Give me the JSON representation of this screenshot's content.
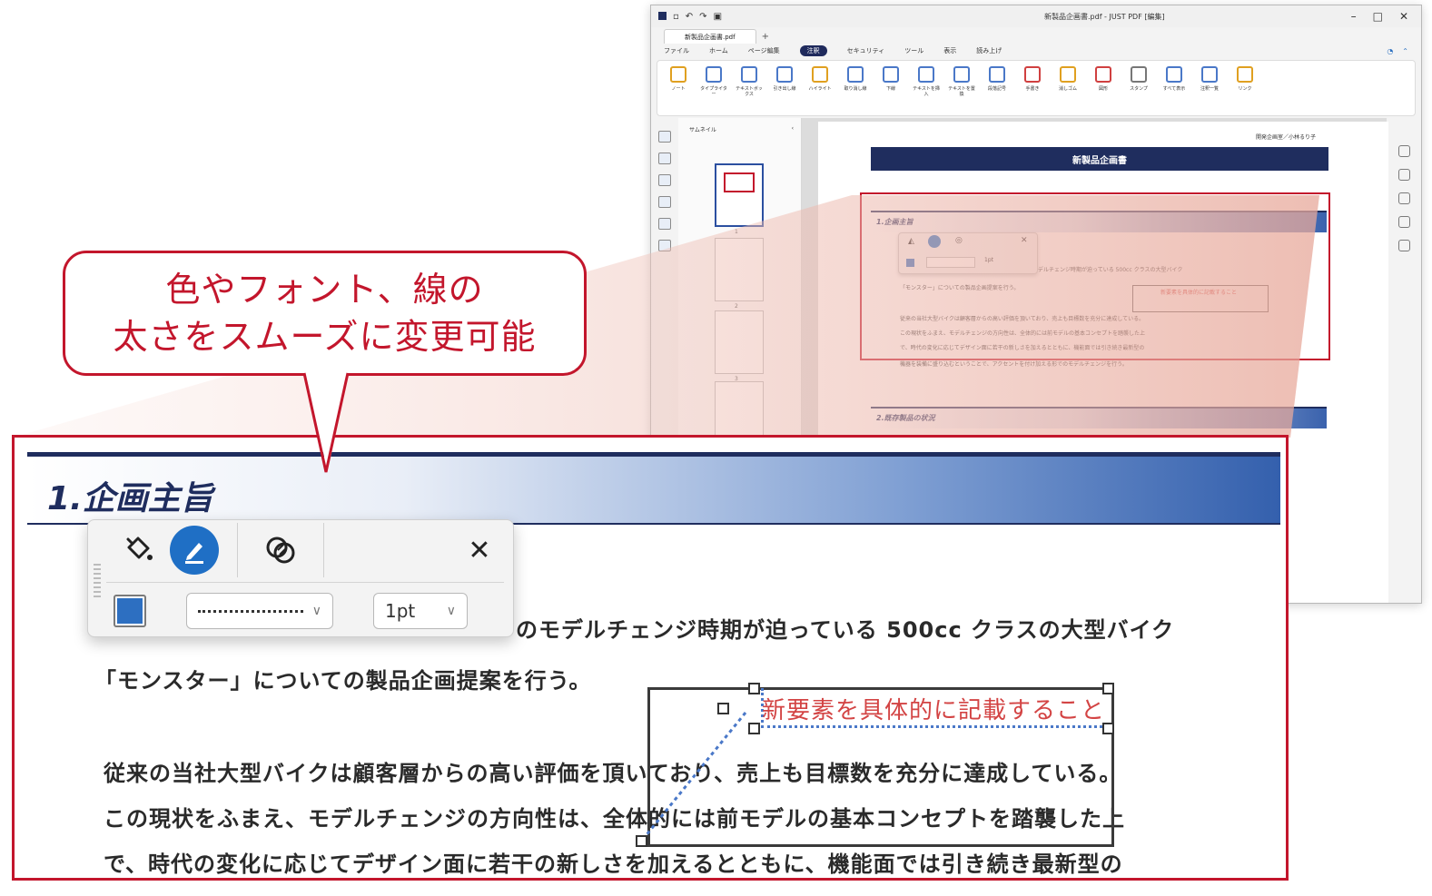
{
  "callout": {
    "line1": "色やフォント、線の",
    "line2": "太さをスムーズに変更可能"
  },
  "window": {
    "title": "新製品企画書.pdf - JUST PDF [編集]",
    "doc_tab": "新製品企画書.pdf",
    "window_controls": [
      "–",
      "□",
      "✕"
    ],
    "menus": [
      "ファイル",
      "ホーム",
      "ページ編集",
      "注釈",
      "セキュリティ",
      "ツール",
      "表示",
      "読み上げ"
    ],
    "active_menu": "注釈",
    "ribbon": [
      {
        "label": "ノート",
        "icon": "note-icon",
        "color": "#e0a020"
      },
      {
        "label": "タイプライター",
        "icon": "typewriter-icon",
        "color": "#4a78c8"
      },
      {
        "label": "テキストボックス",
        "icon": "textbox-icon",
        "color": "#4a78c8"
      },
      {
        "label": "引き出し線",
        "icon": "callout-icon",
        "color": "#4a78c8"
      },
      {
        "label": "ハイライト",
        "icon": "highlight-icon",
        "color": "#e0a020"
      },
      {
        "label": "取り消し線",
        "icon": "strikethrough-icon",
        "color": "#4a78c8"
      },
      {
        "label": "下線",
        "icon": "underline-icon",
        "color": "#4a78c8"
      },
      {
        "label": "テキストを挿入",
        "icon": "insert-text-icon",
        "color": "#4a78c8"
      },
      {
        "label": "テキストを置換",
        "icon": "replace-text-icon",
        "color": "#4a78c8"
      },
      {
        "label": "段落記号",
        "icon": "paragraph-icon",
        "color": "#4a78c8"
      },
      {
        "label": "手書き",
        "icon": "pencil-icon",
        "color": "#d04040"
      },
      {
        "label": "消しゴム",
        "icon": "eraser-icon",
        "color": "#e0a020"
      },
      {
        "label": "図形",
        "icon": "shapes-icon",
        "color": "#d04040"
      },
      {
        "label": "スタンプ",
        "icon": "stamp-icon",
        "color": "#777777"
      },
      {
        "label": "すべて表示",
        "icon": "show-all-icon",
        "color": "#4a78c8"
      },
      {
        "label": "注釈一覧",
        "icon": "annotation-list-icon",
        "color": "#4a78c8"
      },
      {
        "label": "リンク",
        "icon": "link-icon",
        "color": "#e0a020"
      }
    ],
    "thumbnail_panel_title": "サムネイル",
    "page_numbers": [
      "1",
      "2",
      "3",
      "4"
    ],
    "small_page": {
      "author": "開発企画室／小林るり子",
      "title": "新製品企画書",
      "section1": "1.企画主旨",
      "section2": "2.既存製品の状況",
      "lines": [
        "のモデルチェンジ時期が迫っている 500cc クラスの大型バイク",
        "「モンスター」についての製品企画提案を行う。",
        "従来の当社大型バイクは顧客層からの高い評価を頂いており、売上も目標数を充分に達成している。",
        "この現状をふまえ、モデルチェンジの方向性は、全体的には前モデルの基本コンセプトを踏襲した上",
        "で、時代の変化に応じてデザイン面に若干の新しさを加えるとともに、機能面では引き続き最新型の",
        "機器を装備に盛り込むということで、アクセントを付け加える形でのモデルチェンジを行う。"
      ],
      "note_text": "新要素を具体的に記載すること",
      "line_width": "1pt"
    }
  },
  "zoom": {
    "heading": "1.企画主旨",
    "lines": [
      "のモデルチェンジ時期が迫っている 500cc クラスの大型バイク",
      "「モンスター」についての製品企画提案を行う。",
      "従来の当社大型バイクは顧客層からの高い評価を頂いており、売上も目標数を充分に達成している。",
      "この現状をふまえ、モデルチェンジの方向性は、全体的には前モデルの基本コンセプトを踏襲した上",
      "で、時代の変化に応じてデザイン面に若干の新しさを加えるとともに、機能面では引き続き最新型の"
    ],
    "toolbar": {
      "close": "✕",
      "line_width": "1pt",
      "fill_color": "#2d6fc1",
      "accent_color": "#1f6fc5"
    },
    "note_text": "新要素を具体的に記載すること"
  },
  "colors": {
    "accent_red": "#c3162c",
    "navy": "#1f2d5e",
    "note_red": "#d34444"
  }
}
